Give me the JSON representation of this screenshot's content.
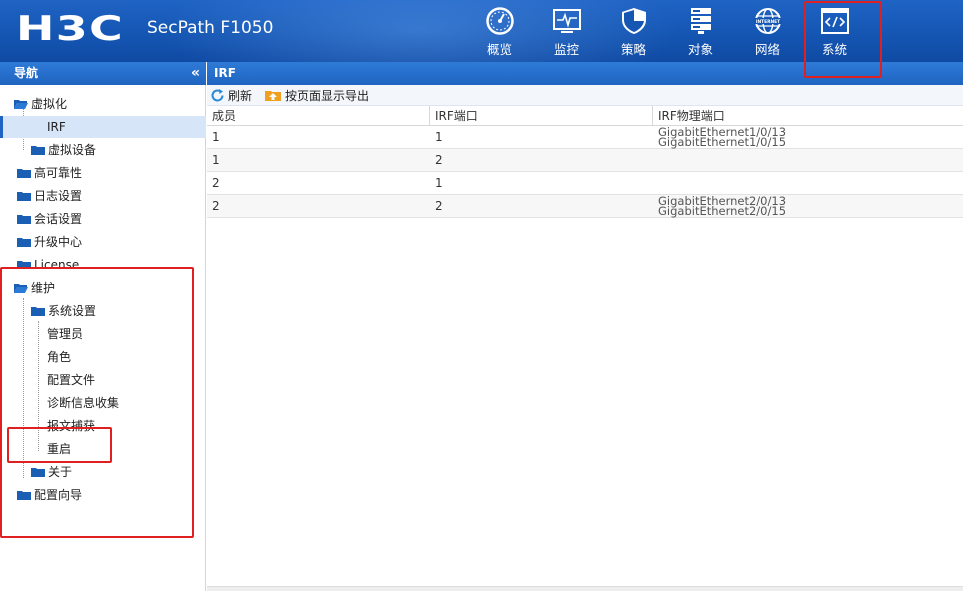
{
  "header": {
    "logo": "H3C",
    "product": "SecPath F1050",
    "nav": [
      {
        "label": "概览",
        "icon": "dashboard-icon"
      },
      {
        "label": "监控",
        "icon": "monitor-icon"
      },
      {
        "label": "策略",
        "icon": "shield-icon"
      },
      {
        "label": "对象",
        "icon": "server-icon"
      },
      {
        "label": "网络",
        "icon": "internet-icon",
        "badge": "INTERNET"
      },
      {
        "label": "系统",
        "icon": "code-window-icon"
      }
    ]
  },
  "sidebar": {
    "title": "导航",
    "collapse": "«",
    "items": [
      {
        "label": "虚拟化"
      },
      {
        "label": "IRF"
      },
      {
        "label": "虚拟设备"
      },
      {
        "label": "高可靠性"
      },
      {
        "label": "日志设置"
      },
      {
        "label": "会话设置"
      },
      {
        "label": "升级中心"
      },
      {
        "label": "License"
      },
      {
        "label": "维护"
      },
      {
        "label": "系统设置"
      },
      {
        "label": "管理员"
      },
      {
        "label": "角色"
      },
      {
        "label": "配置文件"
      },
      {
        "label": "诊断信息收集"
      },
      {
        "label": "报文捕获"
      },
      {
        "label": "重启"
      },
      {
        "label": "关于"
      },
      {
        "label": "配置向导"
      }
    ]
  },
  "main": {
    "title": "IRF",
    "toolbar": {
      "refresh": "刷新",
      "export": "按页面显示导出"
    },
    "columns": [
      "成员",
      "IRF端口",
      "IRF物理端口"
    ],
    "rows": [
      {
        "member": "1",
        "port": "1",
        "phys": [
          "GigabitEthernet1/0/13",
          "GigabitEthernet1/0/15"
        ]
      },
      {
        "member": "1",
        "port": "2",
        "phys": [
          "",
          ""
        ]
      },
      {
        "member": "2",
        "port": "1",
        "phys": [
          "",
          ""
        ]
      },
      {
        "member": "2",
        "port": "2",
        "phys": [
          "GigabitEthernet2/0/13",
          "GigabitEthernet2/0/15"
        ]
      }
    ]
  },
  "colors": {
    "header": "#1556b3",
    "bar": "#1f64c0",
    "folder": "#1a5fb4",
    "annotation": "#e02020"
  }
}
